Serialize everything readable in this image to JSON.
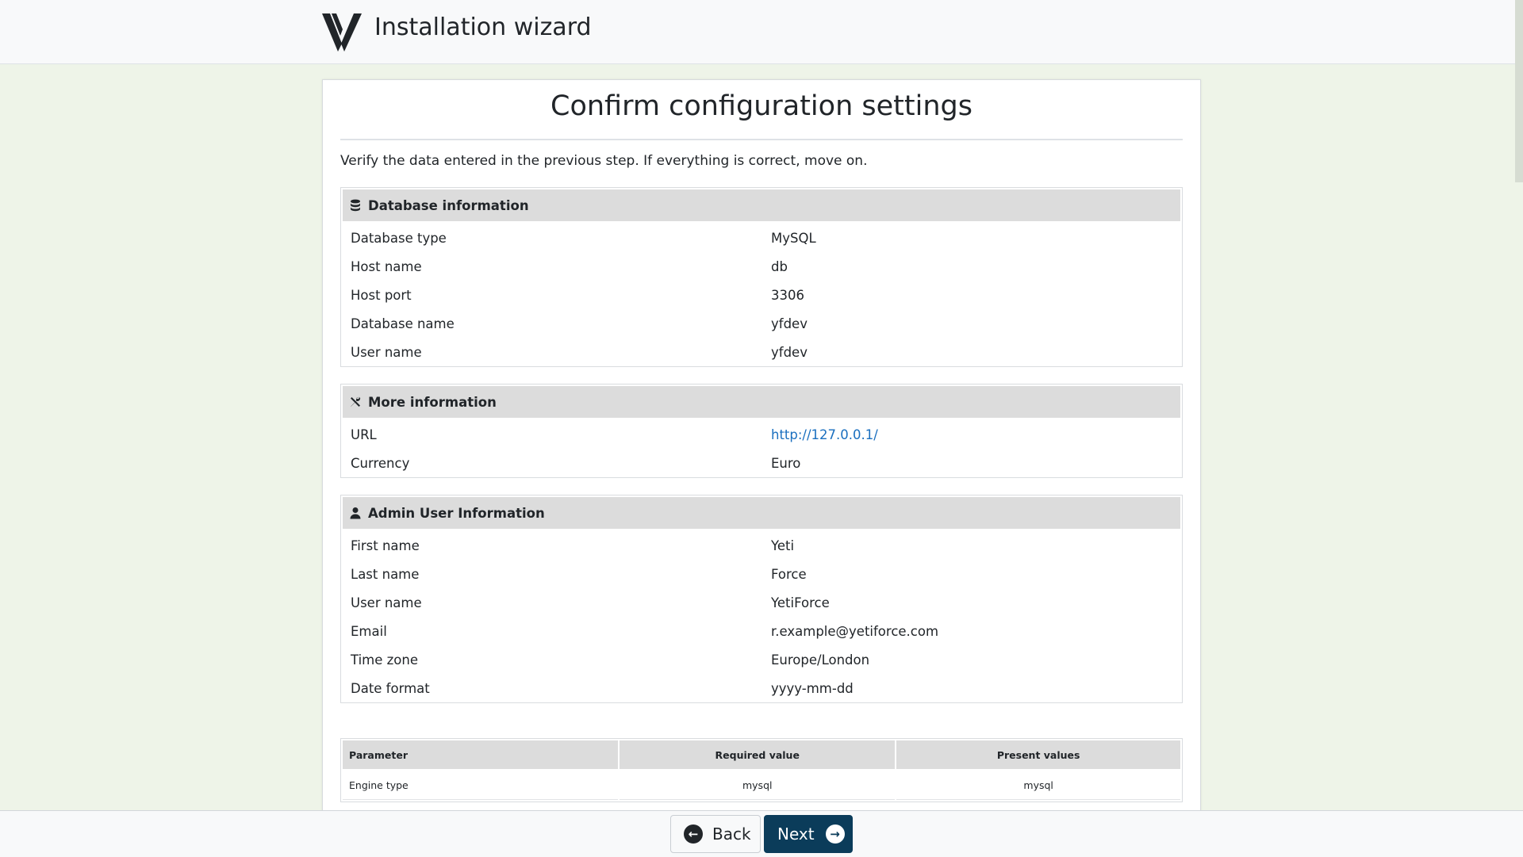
{
  "header": {
    "title": "Installation wizard"
  },
  "page": {
    "title": "Confirm configuration settings",
    "intro": "Verify the data entered in the previous step. If everything is correct, move on."
  },
  "database": {
    "heading": "Database information",
    "icon": "database-icon",
    "rows": [
      {
        "label": "Database type",
        "value": "MySQL"
      },
      {
        "label": "Host name",
        "value": "db"
      },
      {
        "label": "Host port",
        "value": "3306"
      },
      {
        "label": "Database name",
        "value": "yfdev"
      },
      {
        "label": "User name",
        "value": "yfdev"
      }
    ]
  },
  "more": {
    "heading": "More information",
    "icon": "tools-icon",
    "rows": [
      {
        "label": "URL",
        "value": "http://127.0.0.1/"
      },
      {
        "label": "Currency",
        "value": "Euro"
      }
    ]
  },
  "admin": {
    "heading": "Admin User Information",
    "icon": "user-icon",
    "rows": [
      {
        "label": "First name",
        "value": "Yeti"
      },
      {
        "label": "Last name",
        "value": "Force"
      },
      {
        "label": "User name",
        "value": "YetiForce"
      },
      {
        "label": "Email",
        "value": "r.example@yetiforce.com"
      },
      {
        "label": "Time zone",
        "value": "Europe/London"
      },
      {
        "label": "Date format",
        "value": "yyyy-mm-dd"
      }
    ]
  },
  "params": {
    "headers": [
      "Parameter",
      "Required value",
      "Present values"
    ],
    "rows": [
      [
        "Engine type",
        "mysql",
        "mysql"
      ]
    ]
  },
  "footer": {
    "back_label": "Back",
    "next_label": "Next"
  },
  "colors": {
    "accent": "#0b3c5a",
    "link": "#1a6fbf",
    "panel_header": "#dcdcdc"
  }
}
